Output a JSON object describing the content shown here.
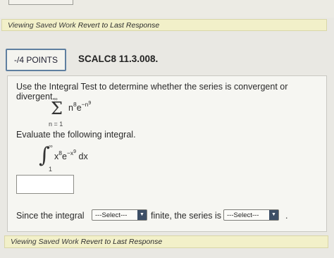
{
  "saved_bar_top": {
    "label": "Viewing Saved Work",
    "link": "Revert to Last Response"
  },
  "header": {
    "points": "-/4 POINTS",
    "question_id": "SCALC8 11.3.008."
  },
  "question": {
    "prompt": "Use the Integral Test to determine whether the series is convergent or divergent.",
    "series": {
      "upper": "∞",
      "lower": "n = 1",
      "base1": "n",
      "exp1": "8",
      "base2": "e",
      "exp2": "−n",
      "exp2_sup": "9"
    },
    "evaluate_prompt": "Evaluate the following integral.",
    "integral": {
      "upper": "∞",
      "lower": "1",
      "base1": "x",
      "exp1": "8",
      "base2": "e",
      "exp2": "−x",
      "exp2_sup": "9",
      "dx": " dx"
    },
    "answer_value": "",
    "since_prefix": "Since the integral",
    "select1": {
      "selected": "---Select---"
    },
    "since_middle": "finite, the series is",
    "select2": {
      "selected": "---Select---"
    },
    "since_suffix": "."
  },
  "saved_bar_bottom": {
    "label": "Viewing Saved Work",
    "link": "Revert to Last Response"
  },
  "colors": {
    "saved_bar_bg": "#f2f0c9",
    "points_border": "#5f7fa0",
    "select_arrow_bg": "#3d4f66"
  }
}
